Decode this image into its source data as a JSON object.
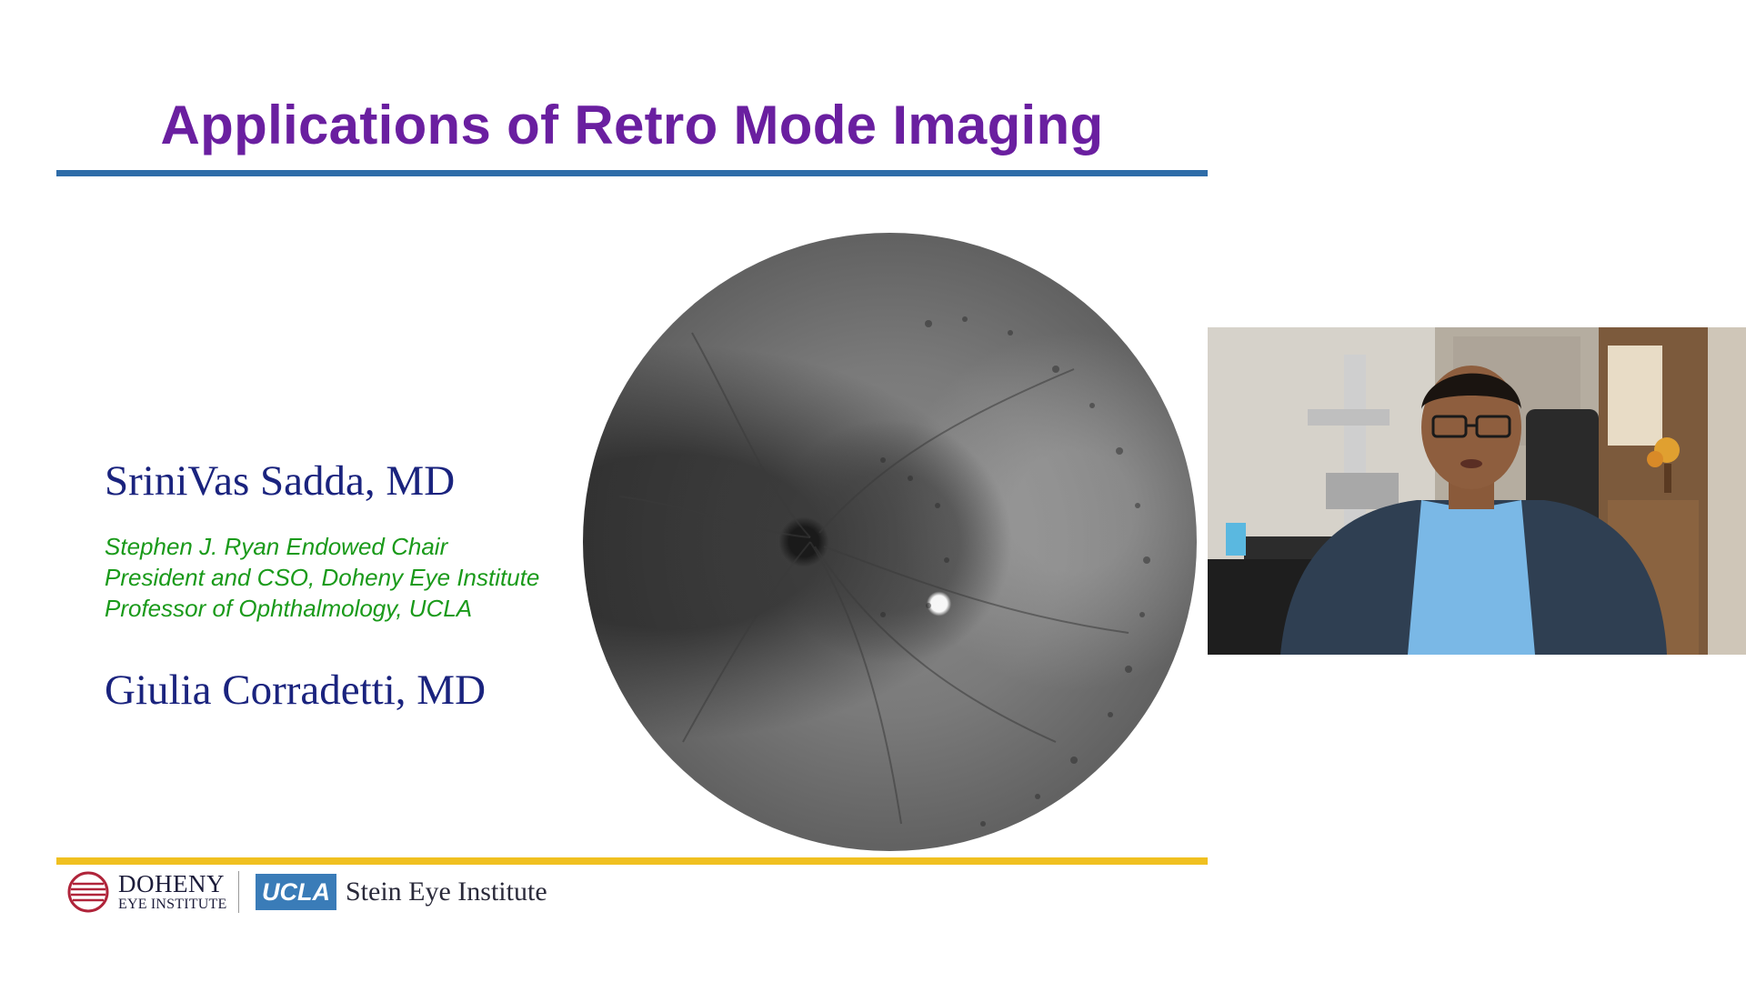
{
  "slide": {
    "title": "Applications of Retro Mode Imaging",
    "speakers": [
      {
        "name": "SriniVas Sadda, MD",
        "affiliations": [
          "Stephen J. Ryan Endowed Chair",
          "President and CSO, Doheny Eye Institute",
          "Professor of Ophthalmology, UCLA"
        ]
      },
      {
        "name": "Giulia Corradetti, MD"
      }
    ],
    "image": {
      "subject": "retro-mode-fundus-image"
    },
    "footer": {
      "logos": {
        "doheny_name": "DOHENY",
        "doheny_sub": "EYE INSTITUTE",
        "ucla": "UCLA",
        "stein": "Stein Eye Institute"
      }
    }
  },
  "colors": {
    "title": "#6a1fa0",
    "title_rule": "#2e6ca8",
    "footer_rule": "#f0c020",
    "speaker_name": "#1a237e",
    "affiliation": "#1a9a1a",
    "ucla_badge": "#3a7cb8"
  },
  "video": {
    "participant": "speaker-webcam"
  }
}
